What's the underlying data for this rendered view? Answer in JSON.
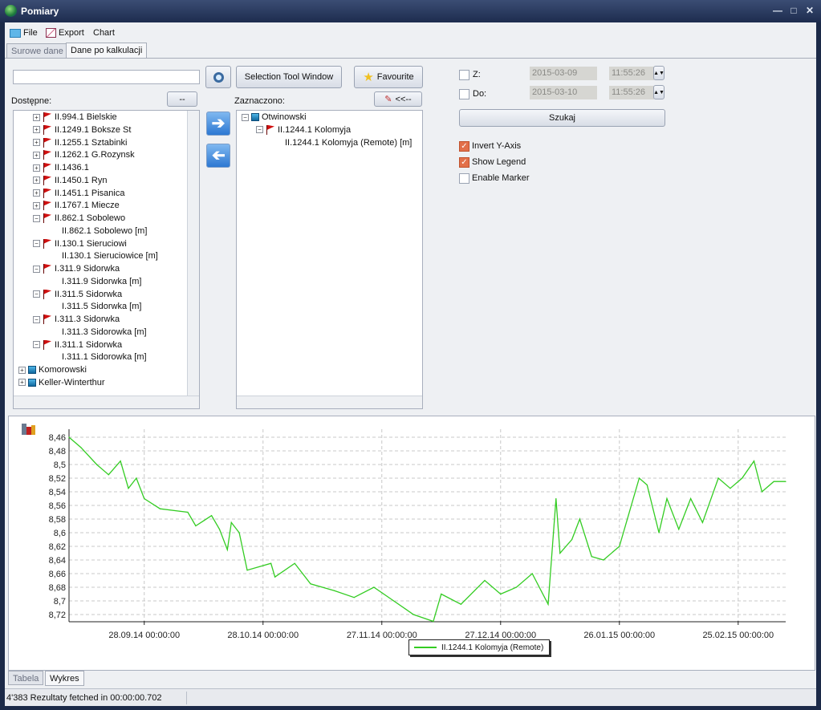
{
  "window": {
    "title": "Pomiary"
  },
  "menu": [
    {
      "label": "File",
      "icon": "folder-icon"
    },
    {
      "label": "Export",
      "icon": "chart-export-icon"
    },
    {
      "label": "Chart"
    }
  ],
  "tabs": [
    {
      "label": "Surowe dane",
      "active": false
    },
    {
      "label": "Dane po kalkulacji",
      "active": true
    }
  ],
  "search": {
    "value": "",
    "placeholder": ""
  },
  "buttons": {
    "selection_tool": "Selection Tool Window",
    "favourite": "Favourite",
    "clear": "--",
    "remove_all": "<<--",
    "search": "Szukaj"
  },
  "available": {
    "label": "Dostępne:",
    "items": [
      {
        "label": "II.994.1 Bielskie",
        "level": 1,
        "type": "flag",
        "exp": "+"
      },
      {
        "label": "II.1249.1 Boksze St",
        "level": 1,
        "type": "flag",
        "exp": "+"
      },
      {
        "label": "II.1255.1 Sztabinki",
        "level": 1,
        "type": "flag",
        "exp": "+"
      },
      {
        "label": "II.1262.1 G.Rozynsk",
        "level": 1,
        "type": "flag",
        "exp": "+"
      },
      {
        "label": "II.1436.1",
        "level": 1,
        "type": "flag",
        "exp": "+"
      },
      {
        "label": "II.1450.1 Ryn",
        "level": 1,
        "type": "flag",
        "exp": "+"
      },
      {
        "label": "II.1451.1 Pisanica",
        "level": 1,
        "type": "flag",
        "exp": "+"
      },
      {
        "label": "II.1767.1 Miecze",
        "level": 1,
        "type": "flag",
        "exp": "+"
      },
      {
        "label": "II.862.1 Sobolewo",
        "level": 1,
        "type": "flag",
        "exp": "-"
      },
      {
        "label": "II.862.1 Sobolewo [m]",
        "level": 2,
        "type": "leaf",
        "exp": ""
      },
      {
        "label": "II.130.1 Sieruciowi",
        "level": 1,
        "type": "flag",
        "exp": "-"
      },
      {
        "label": "II.130.1 Sieruciowice [m]",
        "level": 2,
        "type": "leaf",
        "exp": ""
      },
      {
        "label": "I.311.9 Sidorwka",
        "level": 1,
        "type": "flag",
        "exp": "-"
      },
      {
        "label": "I.311.9 Sidorwka  [m]",
        "level": 2,
        "type": "leaf",
        "exp": ""
      },
      {
        "label": "II.311.5 Sidorwka",
        "level": 1,
        "type": "flag",
        "exp": "-"
      },
      {
        "label": "I.311.5 Sidorwka [m]",
        "level": 2,
        "type": "leaf",
        "exp": ""
      },
      {
        "label": "I.311.3 Sidorwka",
        "level": 1,
        "type": "flag",
        "exp": "-"
      },
      {
        "label": "I.311.3 Sidorowka [m]",
        "level": 2,
        "type": "leaf",
        "exp": ""
      },
      {
        "label": "II.311.1 Sidorwka",
        "level": 1,
        "type": "flag",
        "exp": "-"
      },
      {
        "label": "I.311.1 Sidorowka [m]",
        "level": 2,
        "type": "leaf",
        "exp": ""
      },
      {
        "label": "Komorowski",
        "level": 0,
        "type": "group",
        "exp": "+"
      },
      {
        "label": "Keller-Winterthur",
        "level": 0,
        "type": "group",
        "exp": "+"
      }
    ]
  },
  "selected": {
    "label": "Zaznaczono:",
    "items": [
      {
        "label": "Otwinowski",
        "level": 0,
        "type": "group",
        "exp": "-"
      },
      {
        "label": "II.1244.1 Kolomyja",
        "level": 1,
        "type": "flag",
        "exp": "-"
      },
      {
        "label": "II.1244.1 Kolomyja (Remote) [m]",
        "level": 2,
        "type": "leaf",
        "exp": ""
      }
    ]
  },
  "filter": {
    "from_label": "Z:",
    "from_date": "2015-03-09",
    "from_time": "11:55:26",
    "to_label": "Do:",
    "to_date": "2015-03-10",
    "to_time": "11:55:26",
    "from_checked": false,
    "to_checked": false
  },
  "options": [
    {
      "label": "Invert Y-Axis",
      "checked": true
    },
    {
      "label": "Show Legend",
      "checked": true
    },
    {
      "label": "Enable Marker",
      "checked": false
    }
  ],
  "bottom_tabs": [
    {
      "label": "Tabela",
      "active": false
    },
    {
      "label": "Wykres",
      "active": true
    }
  ],
  "status": "4'383 Rezultaty fetched in 00:00:00.702",
  "chart_data": {
    "type": "line",
    "inverted_y": true,
    "grid": true,
    "legend_placement": "bottom",
    "ylim": [
      8.46,
      8.72
    ],
    "yticks": [
      "8,46",
      "8,48",
      "8,5",
      "8,52",
      "8,54",
      "8,56",
      "8,58",
      "8,6",
      "8,62",
      "8,64",
      "8,66",
      "8,68",
      "8,7",
      "8,72"
    ],
    "xticks": [
      {
        "date": "2014-09-28",
        "label": "28.09.14 00:00:00"
      },
      {
        "date": "2014-10-28",
        "label": "28.10.14 00:00:00"
      },
      {
        "date": "2014-11-27",
        "label": "27.11.14 00:00:00"
      },
      {
        "date": "2014-12-27",
        "label": "27.12.14 00:00:00"
      },
      {
        "date": "2015-01-26",
        "label": "26.01.15 00:00:00"
      },
      {
        "date": "2015-02-25",
        "label": "25.02.15 00:00:00"
      }
    ],
    "xlim": [
      "2014-09-09",
      "2015-03-09"
    ],
    "series": [
      {
        "name": "II.1244.1 Kolomyja (Remote)",
        "color": "#33cc22",
        "x": [
          "2014-09-09",
          "2014-09-12",
          "2014-09-16",
          "2014-09-19",
          "2014-09-22",
          "2014-09-24",
          "2014-09-26",
          "2014-09-28",
          "2014-10-02",
          "2014-10-09",
          "2014-10-11",
          "2014-10-15",
          "2014-10-17",
          "2014-10-19",
          "2014-10-20",
          "2014-10-22",
          "2014-10-24",
          "2014-10-30",
          "2014-10-31",
          "2014-11-05",
          "2014-11-09",
          "2014-11-15",
          "2014-11-20",
          "2014-11-25",
          "2014-11-30",
          "2014-12-05",
          "2014-12-10",
          "2014-12-12",
          "2014-12-17",
          "2014-12-23",
          "2014-12-27",
          "2014-12-31",
          "2015-01-04",
          "2015-01-08",
          "2015-01-10",
          "2015-01-11",
          "2015-01-14",
          "2015-01-16",
          "2015-01-19",
          "2015-01-22",
          "2015-01-26",
          "2015-01-31",
          "2015-02-02",
          "2015-02-05",
          "2015-02-07",
          "2015-02-10",
          "2015-02-13",
          "2015-02-16",
          "2015-02-20",
          "2015-02-23",
          "2015-02-26",
          "2015-03-01",
          "2015-03-03",
          "2015-03-06",
          "2015-03-09"
        ],
        "y": [
          8.46,
          8.475,
          8.5,
          8.515,
          8.495,
          8.535,
          8.52,
          8.55,
          8.565,
          8.57,
          8.59,
          8.575,
          8.595,
          8.625,
          8.585,
          8.6,
          8.655,
          8.645,
          8.665,
          8.645,
          8.675,
          8.685,
          8.695,
          8.68,
          8.7,
          8.72,
          8.73,
          8.69,
          8.705,
          8.67,
          8.69,
          8.68,
          8.66,
          8.705,
          8.55,
          8.63,
          8.61,
          8.58,
          8.635,
          8.64,
          8.62,
          8.52,
          8.53,
          8.6,
          8.55,
          8.595,
          8.55,
          8.585,
          8.52,
          8.535,
          8.52,
          8.495,
          8.54,
          8.525,
          8.525
        ]
      }
    ]
  }
}
